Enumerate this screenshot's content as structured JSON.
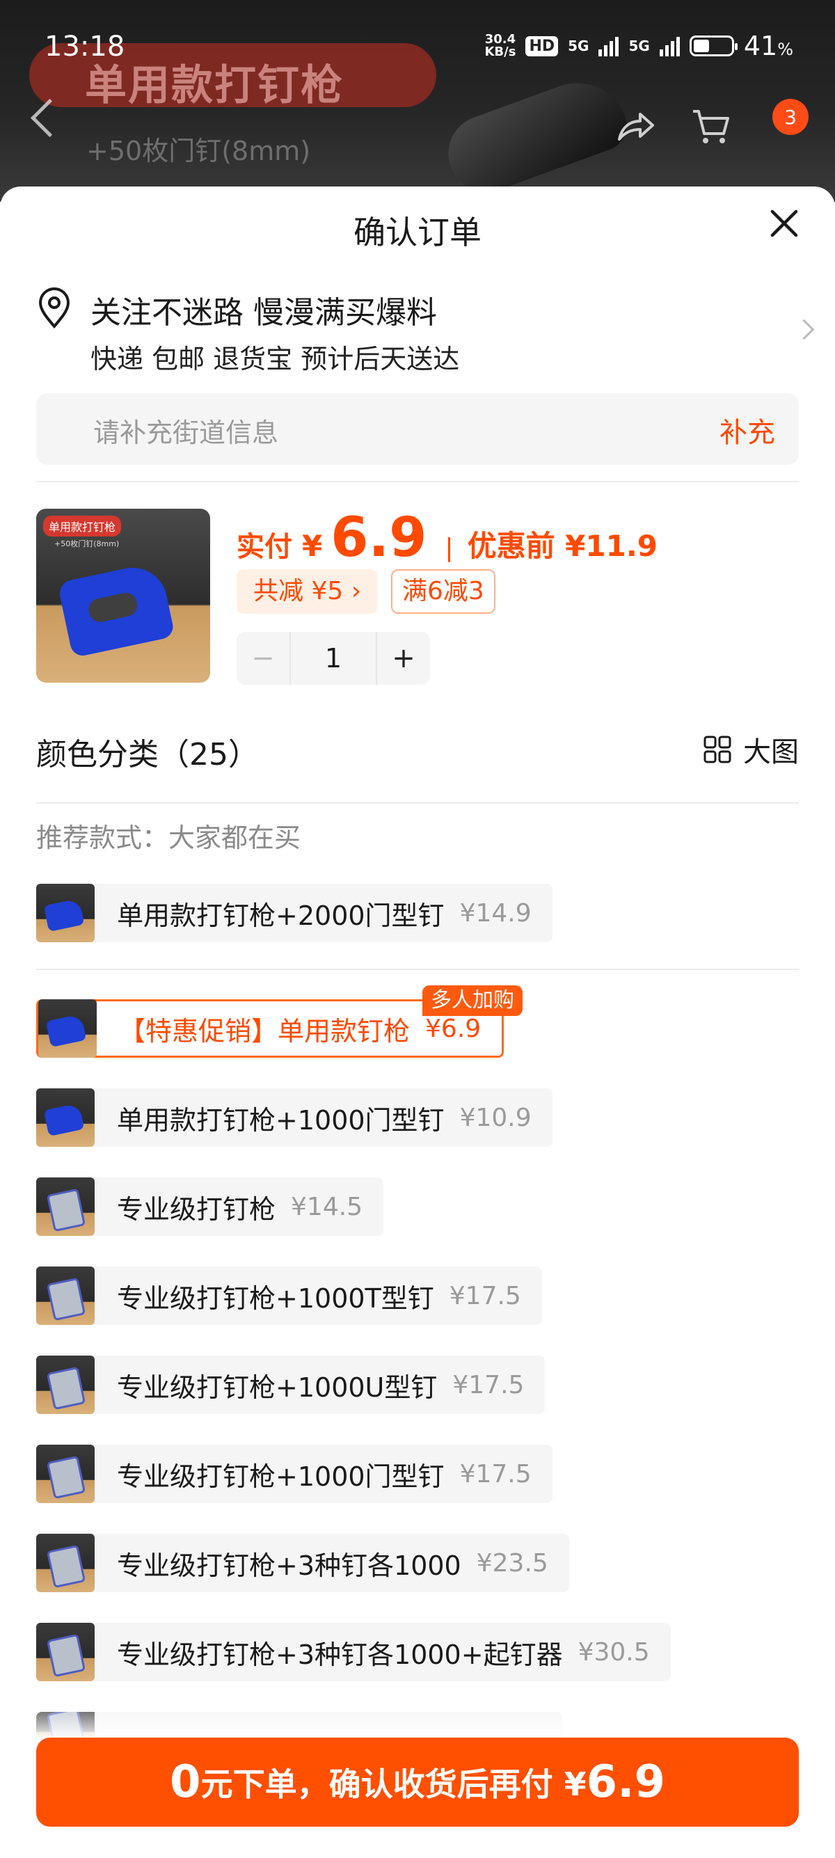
{
  "status_bar": {
    "time": "13:18",
    "net_speed_value": "30.4",
    "net_speed_unit": "KB/s",
    "hd": "HD",
    "sim1": "5G",
    "sim2": "5G",
    "battery_pct": "41",
    "pct_sign": "%"
  },
  "backdrop": {
    "banner_title": "单用款打钉枪",
    "banner_subtitle": "+50枚门钉(8mm)",
    "cart_badge": "3"
  },
  "sheet": {
    "title": "确认订单"
  },
  "address": {
    "name": "关注不迷路 慢漫满买爆料",
    "info": "快递 包邮 退货宝 预计后天送达"
  },
  "street": {
    "placeholder": "请补充街道信息",
    "button": "补充"
  },
  "product": {
    "thumb_label": "单用款打钉枪",
    "thumb_sublabel": "+50枚门钉(8mm)",
    "paid_label": "实付",
    "currency": "¥",
    "paid_amount": "6.9",
    "separator": "|",
    "before_label": "优惠前 ¥11.9",
    "save_tag": "共减 ¥5 ›",
    "full_discount": "满6减3",
    "quantity": "1",
    "minus": "−",
    "plus": "+"
  },
  "variants_section": {
    "title": "颜色分类（25）",
    "big_view": "大图",
    "recommend": "推荐款式：大家都在买"
  },
  "variants": [
    {
      "name": "单用款打钉枪+2000门型钉",
      "price": "¥14.9"
    },
    {
      "name": "【特惠促销】单用款钉枪",
      "price": "¥6.9",
      "badge": "多人加购"
    },
    {
      "name": "单用款打钉枪+1000门型钉",
      "price": "¥10.9"
    },
    {
      "name": "专业级打钉枪",
      "price": "¥14.5"
    },
    {
      "name": "专业级打钉枪+1000T型钉",
      "price": "¥17.5"
    },
    {
      "name": "专业级打钉枪+1000U型钉",
      "price": "¥17.5"
    },
    {
      "name": "专业级打钉枪+1000门型钉",
      "price": "¥17.5"
    },
    {
      "name": "专业级打钉枪+3种钉各1000",
      "price": "¥23.5"
    },
    {
      "name": "专业级打钉枪+3种钉各1000+起钉器",
      "price": "¥30.5"
    }
  ],
  "cta": {
    "zero": "0",
    "text": "元下单，确认收货后再付 ¥",
    "amount": "6.9"
  },
  "colors": {
    "accent": "#ff4f00",
    "promo_border": "#ff6a1a",
    "muted": "#9a9a9a"
  }
}
